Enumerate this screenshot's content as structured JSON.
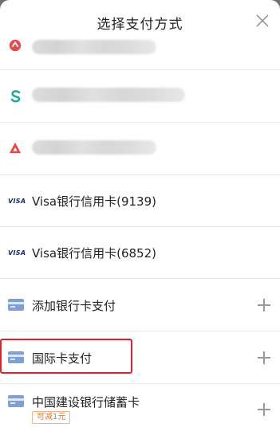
{
  "header": {
    "title": "选择支付方式"
  },
  "rows": [
    {
      "label": "Visa银行信用卡(9139)",
      "brand": "VISA"
    },
    {
      "label": "Visa银行信用卡(6852)",
      "brand": "VISA"
    },
    {
      "label": "添加银行卡支付"
    },
    {
      "label": "国际卡支付"
    },
    {
      "label": "中国建设银行储蓄卡",
      "badge": "可减1元"
    }
  ],
  "colors": {
    "highlight": "#e2222a",
    "card_icon": "#7f9fd6",
    "badge": "#e8742e"
  }
}
